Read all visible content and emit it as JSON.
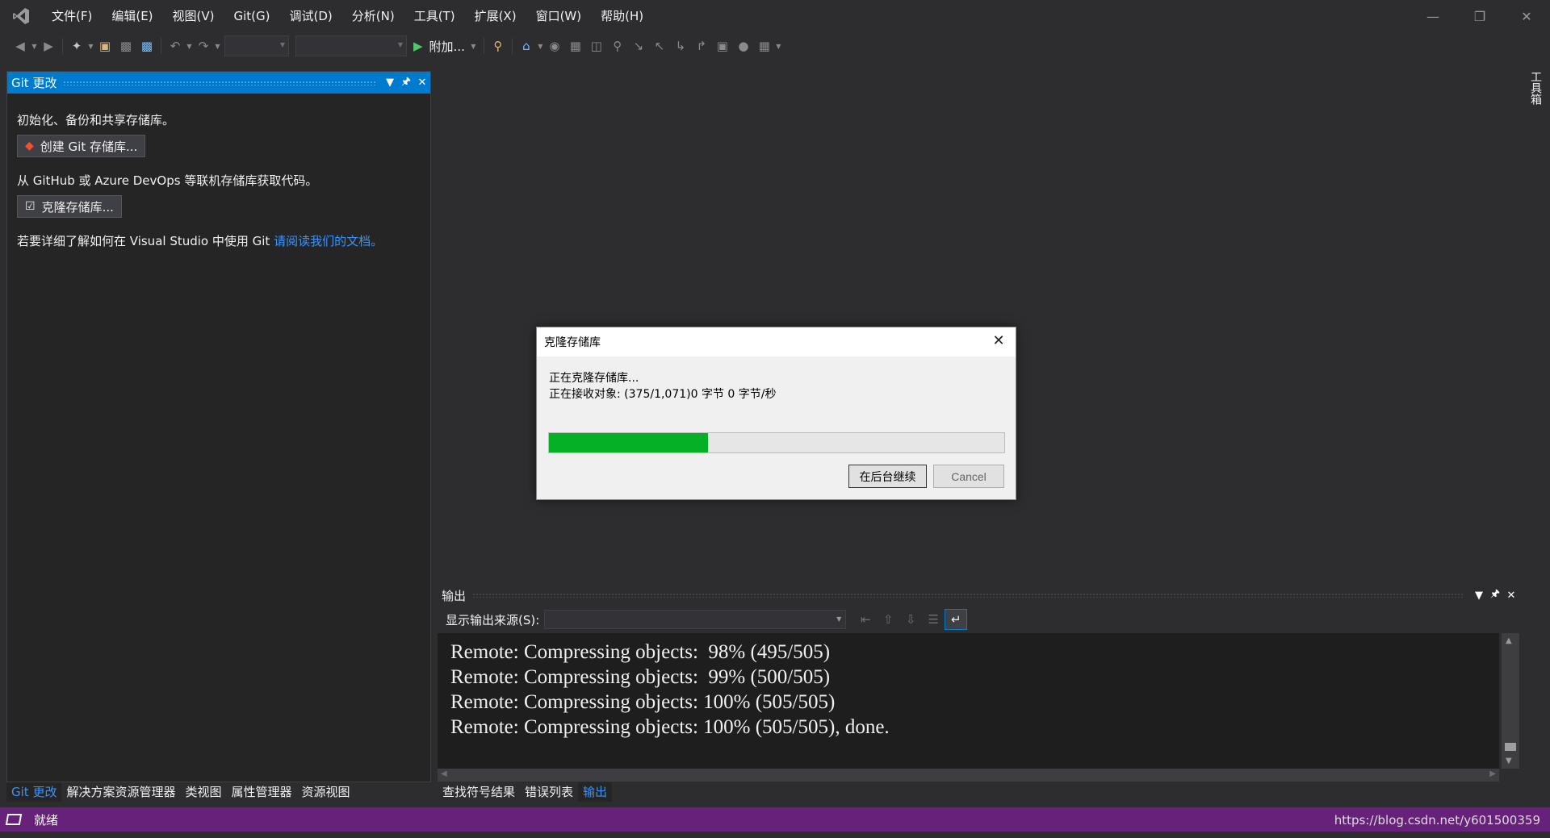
{
  "menu": [
    "文件(F)",
    "编辑(E)",
    "视图(V)",
    "Git(G)",
    "调试(D)",
    "分析(N)",
    "工具(T)",
    "扩展(X)",
    "窗口(W)",
    "帮助(H)"
  ],
  "toolbar": {
    "attach_label": "附加..."
  },
  "toolbox": {
    "label": "工具箱"
  },
  "git_panel": {
    "title": "Git 更改",
    "intro_text": "初始化、备份和共享存储库。",
    "create_button": "创建 Git 存储库...",
    "online_text": "从 GitHub 或 Azure DevOps 等联机存储库获取代码。",
    "clone_button": "克隆存储库...",
    "learn_text": "若要详细了解如何在 Visual Studio 中使用 Git ",
    "learn_link": "请阅读我们的文档",
    "learn_suffix": "。"
  },
  "left_tabs": [
    "Git 更改",
    "解决方案资源管理器",
    "类视图",
    "属性管理器",
    "资源视图"
  ],
  "output_panel": {
    "title": "输出",
    "source_label": "显示输出来源(S):",
    "lines": [
      "Remote: Compressing objects:  98% (495/505)",
      "Remote: Compressing objects:  99% (500/505)",
      "Remote: Compressing objects: 100% (505/505)",
      "Remote: Compressing objects: 100% (505/505), done."
    ]
  },
  "output_tabs": [
    "查找符号结果",
    "错误列表",
    "输出"
  ],
  "statusbar": {
    "text": "就绪",
    "watermark": "https://blog.csdn.net/y601500359"
  },
  "dialog": {
    "title": "克隆存储库",
    "status_line1": "正在克隆存储库...",
    "status_line2": "正在接收对象: (375/1,071)0 字节 0 字节/秒",
    "progress": 0.35,
    "continue_button": "在后台继续",
    "cancel_button": "Cancel"
  },
  "colors": {
    "accent": "#007acc",
    "status_bar": "#68217a",
    "progress": "#06b025",
    "link": "#3794ff"
  }
}
